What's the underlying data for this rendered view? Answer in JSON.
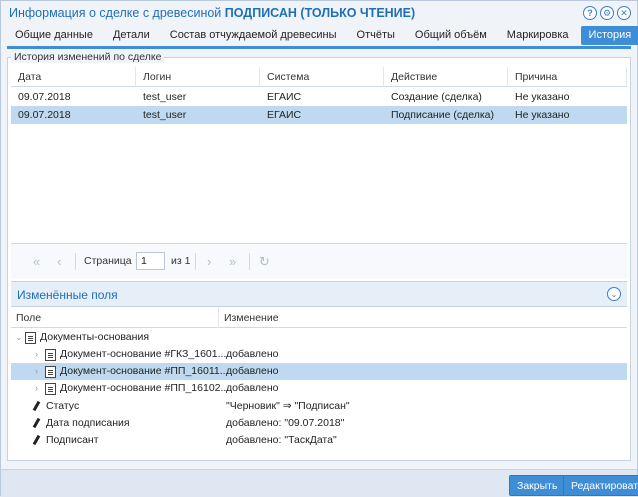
{
  "window": {
    "title_prefix": "Информация о сделке с древесиной",
    "title_bold": "ПОДПИСАН (ТОЛЬКО ЧТЕНИЕ)",
    "icons": [
      "help-icon",
      "gear-icon",
      "close-icon"
    ]
  },
  "tabs": [
    {
      "label": "Общие данные",
      "active": false
    },
    {
      "label": "Детали",
      "active": false
    },
    {
      "label": "Состав отчуждаемой древесины",
      "active": false
    },
    {
      "label": "Отчёты",
      "active": false
    },
    {
      "label": "Общий объём",
      "active": false
    },
    {
      "label": "Маркировка",
      "active": false
    },
    {
      "label": "История",
      "active": true
    }
  ],
  "history": {
    "legend": "История изменений по сделке",
    "columns": [
      "Дата",
      "Логин",
      "Система",
      "Действие",
      "Причина"
    ],
    "rows": [
      {
        "date": "09.07.2018",
        "login": "test_user",
        "system": "ЕГАИС",
        "action": "Создание (сделка)",
        "reason": "Не указано",
        "selected": false
      },
      {
        "date": "09.07.2018",
        "login": "test_user",
        "system": "ЕГАИС",
        "action": "Подписание (сделка)",
        "reason": "Не указано",
        "selected": true
      }
    ]
  },
  "pager": {
    "page_label": "Страница",
    "page_value": "1",
    "of_label": "из 1"
  },
  "changed": {
    "title": "Изменённые поля",
    "columns": [
      "Поле",
      "Изменение"
    ],
    "items": [
      {
        "field": "Документы-основания",
        "change": "",
        "level": 0,
        "icon": "document-icon",
        "arrow": "chevron-down-icon",
        "selected": false
      },
      {
        "field": "Документ-основание #ГКЗ_1601...",
        "change": "добавлено",
        "level": 1,
        "icon": "document-icon",
        "arrow": "chevron-right-icon",
        "selected": false
      },
      {
        "field": "Документ-основание #ПП_16011...",
        "change": "добавлено",
        "level": 1,
        "icon": "document-icon",
        "arrow": "chevron-right-icon",
        "selected": true
      },
      {
        "field": "Документ-основание #ПП_16102...",
        "change": "добавлено",
        "level": 1,
        "icon": "document-icon",
        "arrow": "chevron-right-icon",
        "selected": false
      },
      {
        "field": "Статус",
        "change": "\"Черновик\" ⇒ \"Подписан\"",
        "level": 0,
        "icon": "pencil-icon",
        "arrow": "",
        "selected": false
      },
      {
        "field": "Дата подписания",
        "change": "добавлено: \"09.07.2018\"",
        "level": 0,
        "icon": "pencil-icon",
        "arrow": "",
        "selected": false
      },
      {
        "field": "Подписант",
        "change": "добавлено: \"ТаскДата\"",
        "level": 0,
        "icon": "pencil-icon",
        "arrow": "",
        "selected": false
      }
    ]
  },
  "footer": {
    "close_label": "Закрыть",
    "edit_label": "Редактировать"
  }
}
